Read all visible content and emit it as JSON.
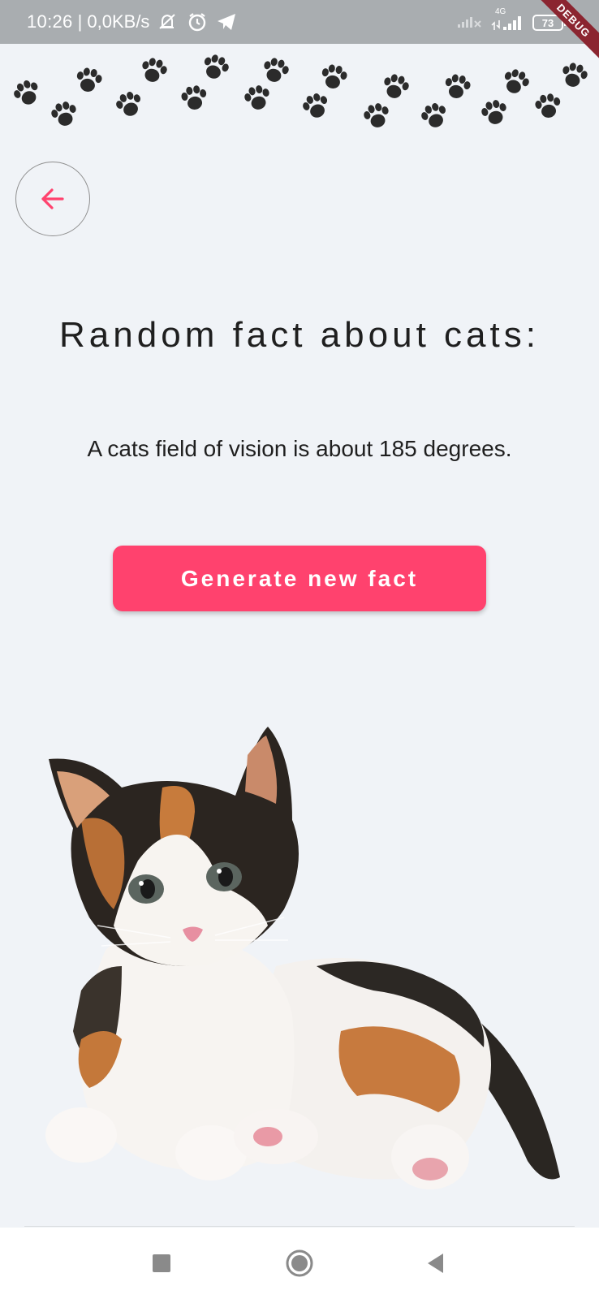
{
  "status_bar": {
    "time": "10:26",
    "network_speed": "| 0,0KB/s",
    "network_type": "4G",
    "battery": "73",
    "debug_banner": "DEBUG"
  },
  "title": "Random fact about cats:",
  "fact": "A cats field of vision is about 185 degrees.",
  "generate_button_label": "Generate new fact",
  "colors": {
    "accent": "#ff426e",
    "background": "#f0f3f7",
    "status_bar": "#a9adb0",
    "paw": "#2b2b2b"
  },
  "icons": {
    "back": "arrow-left-icon",
    "paw": "paw-print-icon",
    "nav_recents": "square-icon",
    "nav_home": "circle-icon",
    "nav_back": "triangle-back-icon"
  }
}
